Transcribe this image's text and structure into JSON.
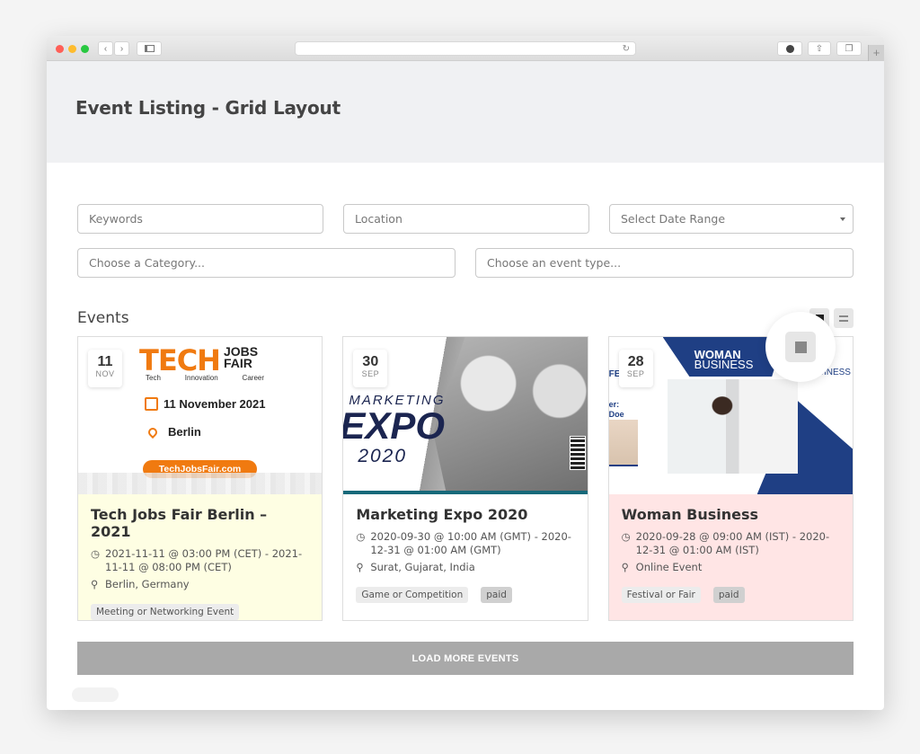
{
  "browser": {
    "traffic_lights": [
      "#ff5f57",
      "#febc2e",
      "#28c840"
    ],
    "nav_back_icon": "chevron-left-icon",
    "nav_forward_icon": "chevron-right-icon",
    "sidebar_icon": "sidebar-icon",
    "reload_icon": "reload-icon",
    "download_icon": "download-icon",
    "share_icon": "share-icon",
    "tabs_icon": "tabs-icon",
    "new_tab": "+"
  },
  "header": {
    "title": "Event Listing - Grid Layout"
  },
  "filters": {
    "keywords_placeholder": "Keywords",
    "location_placeholder": "Location",
    "date_range_placeholder": "Select Date Range",
    "category_placeholder": "Choose a Category...",
    "event_type_placeholder": "Choose an event type..."
  },
  "events_section": {
    "title": "Events",
    "view_modes": [
      "grid",
      "list"
    ],
    "active_view": "grid"
  },
  "events": [
    {
      "day": "11",
      "month": "NOV",
      "title": "Tech Jobs Fair Berlin – 2021",
      "time": "2021-11-11 @ 03:00 PM (CET) - 2021-11-11 @ 08:00 PM (CET)",
      "location": "Berlin, Germany",
      "tags": [
        "Meeting or Networking Event"
      ],
      "bg": "#fefee3",
      "banner": {
        "logo_main": "TECH",
        "logo_side1": "JOBS",
        "logo_side2": "FAIR",
        "sub": [
          "Tech",
          "Innovation",
          "Career"
        ],
        "date": "11 November 2021",
        "city": "Berlin",
        "site": "TechJobsFair.com"
      }
    },
    {
      "day": "30",
      "month": "SEP",
      "title": "Marketing Expo 2020",
      "time": "2020-09-30 @ 10:00 AM (GMT) - 2020-12-31 @ 01:00 AM (GMT)",
      "location": "Surat, Gujarat, India",
      "tags": [
        "Game or Competition",
        "paid"
      ],
      "bg": "#ffffff",
      "banner": {
        "line1": "MARKETING",
        "line2": "EXPO",
        "line3": "2020"
      }
    },
    {
      "day": "28",
      "month": "SEP",
      "title": "Woman Business",
      "time": "2020-09-28 @ 09:00 AM (IST) - 2020-12-31 @ 01:00 AM (IST)",
      "location": "Online Event",
      "tags": [
        "Festival or Fair",
        "paid"
      ],
      "bg": "#ffe5e5",
      "banner": {
        "line1": "WOMAN",
        "line2": "BUSINESS",
        "side": "BUSINESS",
        "left1": "FE",
        "left2": "er:",
        "left3": "Doe"
      }
    }
  ],
  "load_more": "LOAD MORE EVENTS"
}
